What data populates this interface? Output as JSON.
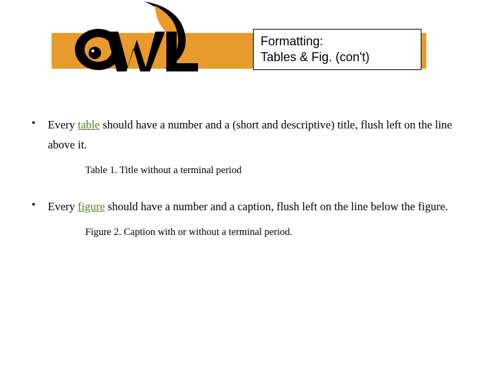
{
  "header": {
    "title_line1": "Formatting:",
    "title_line2": "Tables & Fig. (con't)",
    "logo_text": "OWL"
  },
  "bullets": [
    {
      "pre": "Every ",
      "kw": "table",
      "post": " should have a number and a (short and descriptive) title, flush left on the line above it.",
      "example": "Table 1. Title without a terminal period"
    },
    {
      "pre": "Every ",
      "kw": "figure",
      "post": " should have a number and a caption, flush left on the line below the figure.",
      "example": "Figure 2. Caption with or without a terminal period."
    }
  ]
}
